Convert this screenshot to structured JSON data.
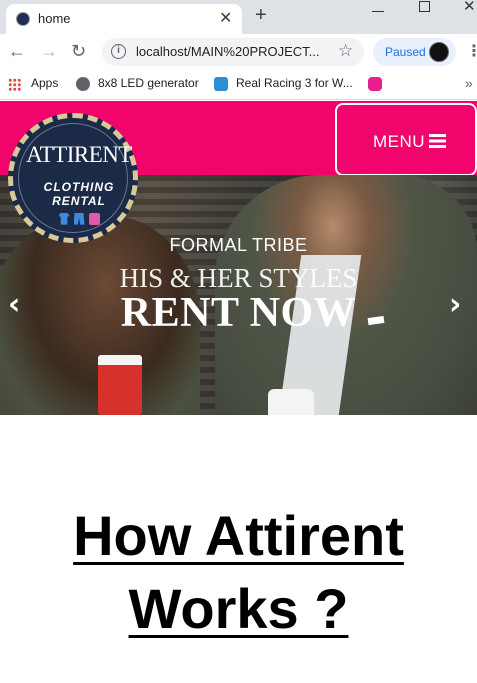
{
  "browser": {
    "tab_title": "home",
    "url": "localhost/MAIN%20PROJECT...",
    "profile_status": "Paused",
    "bookmarks": [
      {
        "label": "Apps",
        "icon": "apps-grid-icon"
      },
      {
        "label": "8x8 LED generator",
        "icon": "globe-icon"
      },
      {
        "label": "Real Racing 3 for W...",
        "icon": "racing-icon"
      },
      {
        "label": "",
        "icon": "webassembly-icon"
      }
    ]
  },
  "header": {
    "menu_label": "MENU",
    "accent_color": "#f1056d"
  },
  "logo": {
    "title": "ATTIRENT",
    "line1": "CLOTHING",
    "line2": "RENTAL"
  },
  "hero": {
    "caption1": "FORMAL TRIBE",
    "caption2": "HIS & HER STYLES",
    "caption3": "RENT NOW",
    "prev_arrow": "‹",
    "next_arrow": "›"
  },
  "section": {
    "heading_line1": "How Attirent",
    "heading_line2": "Works ?"
  }
}
